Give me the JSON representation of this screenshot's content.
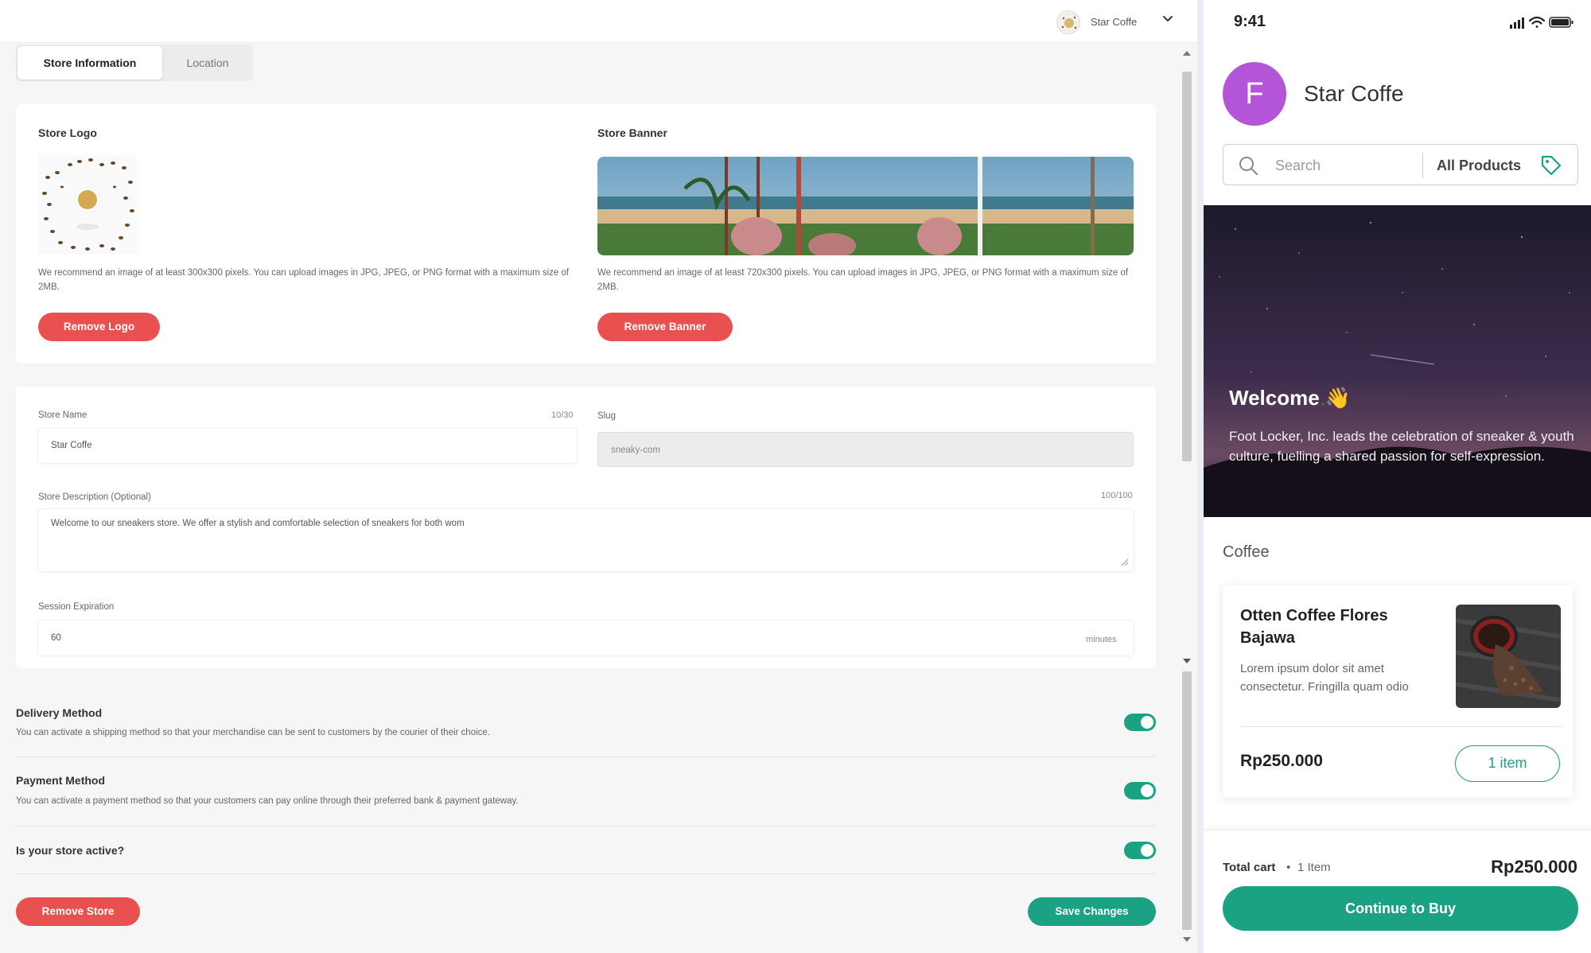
{
  "header": {
    "store_name": "Star Coffe"
  },
  "tabs": [
    {
      "label": "Store Information",
      "active": true
    },
    {
      "label": "Location",
      "active": false
    }
  ],
  "media": {
    "logo": {
      "title": "Store Logo",
      "help": "We recommend an image of at least 300x300 pixels. You can upload images in JPG, JPEG, or PNG format with a maximum size of 2MB.",
      "remove_label": "Remove Logo"
    },
    "banner": {
      "title": "Store Banner",
      "help": "We recommend an image of at least 720x300 pixels. You can upload images in JPG, JPEG, or PNG format with a maximum size of 2MB.",
      "remove_label": "Remove Banner"
    }
  },
  "form": {
    "store_name": {
      "label": "Store Name",
      "counter": "10/30",
      "value": "Star Coffe"
    },
    "slug": {
      "label": "Slug",
      "value": "sneaky-com"
    },
    "description": {
      "label": "Store Description (Optional)",
      "counter": "100/100",
      "value": "Welcome to our sneakers store. We offer a stylish and comfortable selection of sneakers for both wom"
    },
    "session": {
      "label": "Session Expiration",
      "value": "60",
      "suffix": "minutes"
    }
  },
  "settings": {
    "delivery": {
      "title": "Delivery Method",
      "desc": "You can activate a shipping method so that your merchandise can be sent to customers by the courier of their choice.",
      "enabled": true
    },
    "payment": {
      "title": "Payment Method",
      "desc": "You can activate a payment method so that your customers can pay online through their preferred bank & payment gateway.",
      "enabled": true
    },
    "active": {
      "title": "Is your store active?",
      "enabled": true
    }
  },
  "actions": {
    "remove_store": "Remove Store",
    "save": "Save Changes"
  },
  "mobile": {
    "time": "9:41",
    "avatar_initial": "F",
    "store_name": "Star Coffe",
    "search_placeholder": "Search",
    "filter_label": "All Products",
    "welcome_title": "Welcome 👋",
    "welcome_desc": "Foot Locker, Inc. leads the celebration of sneaker & youth culture, fuelling a shared passion for self-expression.",
    "category": "Coffee",
    "product": {
      "name": "Otten Coffee Flores Bajawa",
      "desc": "Lorem ipsum dolor sit amet consectetur. Fringilla quam odio",
      "price": "Rp250.000",
      "qty": "1 item"
    },
    "cart": {
      "label": "Total cart",
      "dot": "•",
      "items": "1 Item",
      "total": "Rp250.000",
      "cta": "Continue to Buy"
    }
  },
  "colors": {
    "brand_green": "#1aa282",
    "danger_red": "#e8514f",
    "avatar_purple": "#b454d6"
  }
}
